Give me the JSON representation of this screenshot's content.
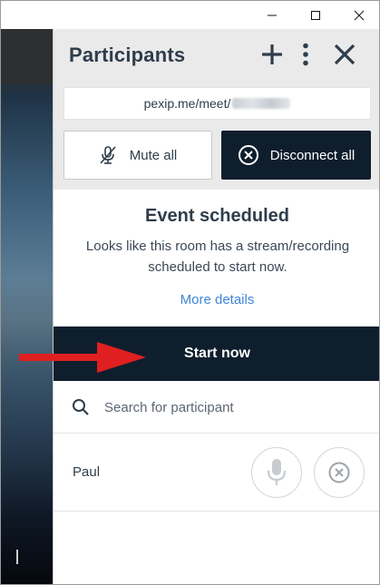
{
  "window": {
    "minimize_icon": "minimize-icon",
    "maximize_icon": "maximize-icon",
    "close_icon": "close-icon"
  },
  "panel": {
    "title": "Participants",
    "add_icon": "plus-icon",
    "more_icon": "vertical-dots-icon",
    "close_icon": "close-icon"
  },
  "meeting": {
    "url_prefix": "pexip.me/meet/"
  },
  "actions": {
    "mute_all": "Mute all",
    "disconnect_all": "Disconnect all"
  },
  "event": {
    "title": "Event scheduled",
    "description": "Looks like this room has a stream/recording scheduled to start now.",
    "more_details": "More details",
    "start_now": "Start now"
  },
  "search": {
    "placeholder": "Search for participant"
  },
  "participants": [
    {
      "name": "Paul"
    }
  ],
  "colors": {
    "dark_navy": "#0f1e2d",
    "header_bg": "#eaeaea",
    "link_blue": "#3f86d6",
    "annotation_red": "#e02020"
  }
}
